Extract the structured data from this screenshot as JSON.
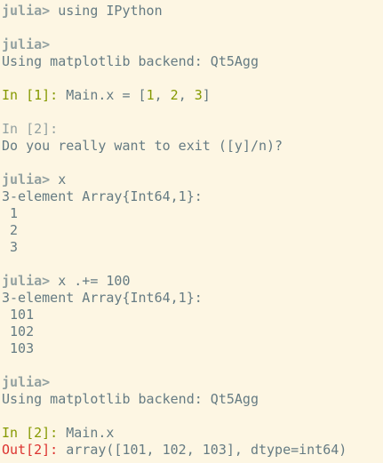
{
  "terminal": {
    "l1": {
      "prompt": "julia>",
      "cmd": " using IPython"
    },
    "l2": {
      "prompt": "julia>"
    },
    "l3": {
      "text": "Using matplotlib backend: Qt5Agg"
    },
    "l4": {
      "in_label": "In [",
      "in_num": "1",
      "in_close": "]: ",
      "code_a": "Main.x = [",
      "n1": "1",
      "sep1": ", ",
      "n2": "2",
      "sep2": ", ",
      "n3": "3",
      "code_end": "]"
    },
    "l5": {
      "text": "In [2]:"
    },
    "l6": {
      "text": "Do you really want to exit ([y]/n)?"
    },
    "l7": {
      "prompt": "julia>",
      "cmd": " x"
    },
    "l8": {
      "text": "3-element Array{Int64,1}:"
    },
    "l9": {
      "text": " 1"
    },
    "l10": {
      "text": " 2"
    },
    "l11": {
      "text": " 3"
    },
    "l12": {
      "prompt": "julia>",
      "cmd": " x .+= 100"
    },
    "l13": {
      "text": "3-element Array{Int64,1}:"
    },
    "l14": {
      "text": " 101"
    },
    "l15": {
      "text": " 102"
    },
    "l16": {
      "text": " 103"
    },
    "l17": {
      "prompt": "julia>"
    },
    "l18": {
      "text": "Using matplotlib backend: Qt5Agg"
    },
    "l19": {
      "in_label": "In [",
      "in_num": "2",
      "in_close": "]: ",
      "code": "Main.x"
    },
    "l20": {
      "out_label": "Out[",
      "out_num": "2",
      "out_close": "]: ",
      "code": "array([101, 102, 103], dtype=int64)"
    }
  },
  "colors": {
    "background": "#fdf6e3",
    "text": "#657b83",
    "prompt": "#93a1a1",
    "in_prompt": "#859900",
    "out_prompt": "#dc322f"
  }
}
